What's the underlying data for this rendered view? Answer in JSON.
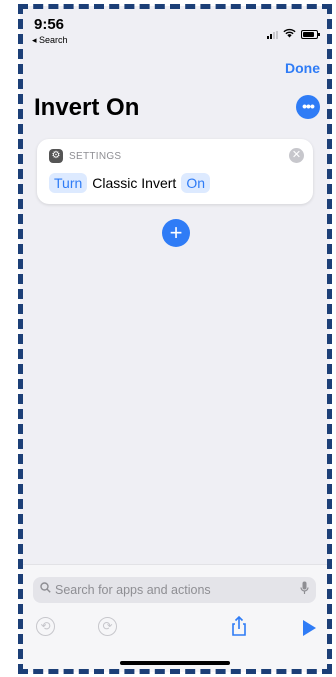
{
  "status": {
    "time": "9:56",
    "back_label": "◂ Search"
  },
  "nav": {
    "done": "Done",
    "title": "Invert On",
    "more_glyph": "•••"
  },
  "action_card": {
    "app_name": "SETTINGS",
    "verb": "Turn",
    "subject": "Classic Invert",
    "state": "On"
  },
  "add_glyph": "+",
  "search": {
    "placeholder": "Search for apps and actions"
  },
  "colors": {
    "accent": "#2f7cf6",
    "background": "#efeff4",
    "frame_border": "#1c3f77"
  },
  "icons": {
    "undo": "undo-icon",
    "redo": "redo-icon",
    "share": "share-icon",
    "run": "play-icon",
    "mic": "microphone-icon",
    "search": "search-icon",
    "settings_app": "gear-icon"
  }
}
